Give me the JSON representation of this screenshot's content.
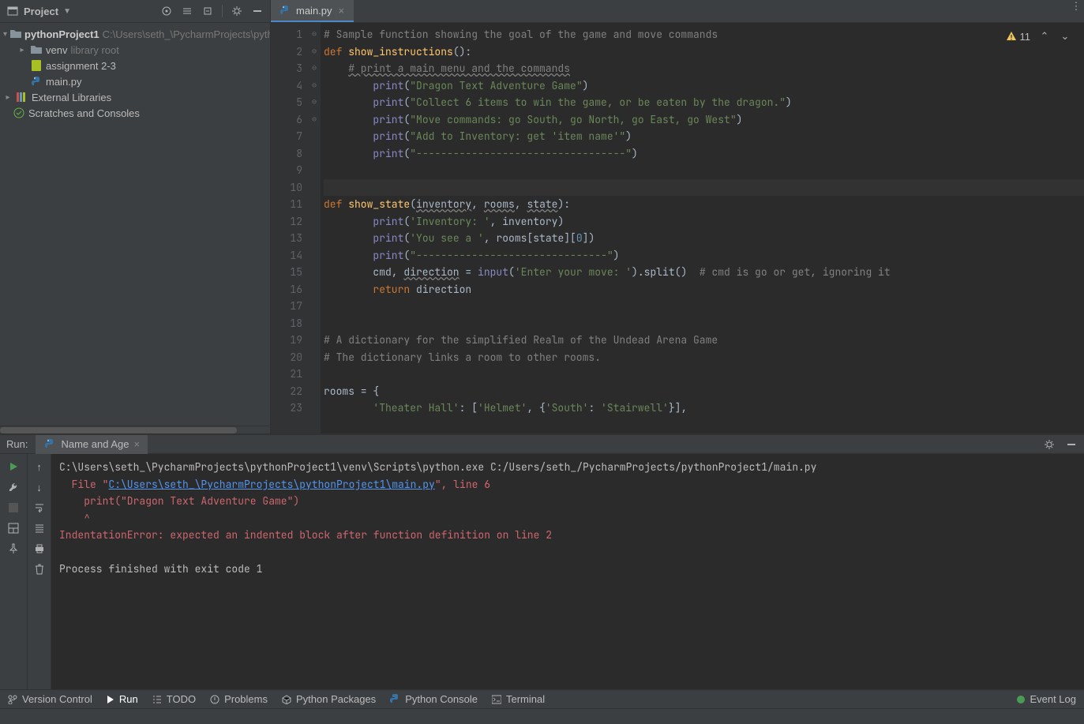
{
  "project_header": {
    "title": "Project"
  },
  "tree": {
    "project": {
      "name": "pythonProject1",
      "path": "C:\\Users\\seth_\\PycharmProjects\\python"
    },
    "venv": {
      "name": "venv",
      "tag": "library root"
    },
    "assign": "assignment 2-3",
    "main": "main.py",
    "ext": "External Libraries",
    "scratch": "Scratches and Consoles"
  },
  "editor_tab": {
    "file": "main.py"
  },
  "inspection": {
    "warn_count": "11"
  },
  "code_lines": [
    {
      "n": 1,
      "seg": [
        {
          "c": "c-cmt",
          "t": "# Sample function showing the goal of the game and move commands"
        }
      ]
    },
    {
      "n": 2,
      "fold": "⊖",
      "seg": [
        {
          "c": "c-kw",
          "t": "def "
        },
        {
          "c": "c-fn",
          "t": "show_instructions"
        },
        {
          "t": "():"
        }
      ]
    },
    {
      "n": 3,
      "seg": [
        {
          "t": "    "
        },
        {
          "c": "c-cmt",
          "t": "# print a main menu and the commands",
          "u": true
        }
      ]
    },
    {
      "n": 4,
      "fold": "⊖",
      "seg": [
        {
          "t": "        "
        },
        {
          "c": "c-blt",
          "t": "print"
        },
        {
          "t": "("
        },
        {
          "c": "c-str",
          "t": "\"Dragon Text Adventure Game\""
        },
        {
          "t": ")"
        }
      ]
    },
    {
      "n": 5,
      "seg": [
        {
          "t": "        "
        },
        {
          "c": "c-blt",
          "t": "print"
        },
        {
          "t": "("
        },
        {
          "c": "c-str",
          "t": "\"Collect 6 items to win the game, or be eaten by the dragon.\""
        },
        {
          "t": ")"
        }
      ]
    },
    {
      "n": 6,
      "seg": [
        {
          "t": "        "
        },
        {
          "c": "c-blt",
          "t": "print"
        },
        {
          "t": "("
        },
        {
          "c": "c-str",
          "t": "\"Move commands: go South, go North, go East, go West\""
        },
        {
          "t": ")"
        }
      ]
    },
    {
      "n": 7,
      "seg": [
        {
          "t": "        "
        },
        {
          "c": "c-blt",
          "t": "print"
        },
        {
          "t": "("
        },
        {
          "c": "c-str",
          "t": "\"Add to Inventory: get 'item name'\""
        },
        {
          "t": ")"
        }
      ]
    },
    {
      "n": 8,
      "fold": "⊖",
      "seg": [
        {
          "t": "        "
        },
        {
          "c": "c-blt",
          "t": "print"
        },
        {
          "t": "("
        },
        {
          "c": "c-str",
          "t": "\"----------------------------------\""
        },
        {
          "t": ")"
        }
      ]
    },
    {
      "n": 9,
      "seg": [
        {
          "t": ""
        }
      ]
    },
    {
      "n": 10,
      "current": true,
      "seg": [
        {
          "t": ""
        }
      ]
    },
    {
      "n": 11,
      "fold": "⊖",
      "seg": [
        {
          "c": "c-kw",
          "t": "def "
        },
        {
          "c": "c-fn",
          "t": "show_state"
        },
        {
          "t": "("
        },
        {
          "c": "c-und",
          "t": "inventory"
        },
        {
          "t": ", "
        },
        {
          "c": "c-und",
          "t": "rooms"
        },
        {
          "t": ", "
        },
        {
          "c": "c-und",
          "t": "state"
        },
        {
          "t": "):"
        }
      ]
    },
    {
      "n": 12,
      "seg": [
        {
          "t": "        "
        },
        {
          "c": "c-blt",
          "t": "print"
        },
        {
          "t": "("
        },
        {
          "c": "c-str",
          "t": "'Inventory: '"
        },
        {
          "t": ", inventory)"
        }
      ]
    },
    {
      "n": 13,
      "seg": [
        {
          "t": "        "
        },
        {
          "c": "c-blt",
          "t": "print"
        },
        {
          "t": "("
        },
        {
          "c": "c-str",
          "t": "'You see a '"
        },
        {
          "t": ", rooms[state]["
        },
        {
          "c": "c-num",
          "t": "0"
        },
        {
          "t": "])"
        }
      ]
    },
    {
      "n": 14,
      "seg": [
        {
          "t": "        "
        },
        {
          "c": "c-blt",
          "t": "print"
        },
        {
          "t": "("
        },
        {
          "c": "c-str",
          "t": "\"-------------------------------\""
        },
        {
          "t": ")"
        }
      ]
    },
    {
      "n": 15,
      "seg": [
        {
          "t": "        cmd, "
        },
        {
          "c": "c-und",
          "t": "direction"
        },
        {
          "t": " = "
        },
        {
          "c": "c-blt",
          "t": "input"
        },
        {
          "t": "("
        },
        {
          "c": "c-str",
          "t": "'Enter your move: '"
        },
        {
          "t": ").split()  "
        },
        {
          "c": "c-cmt",
          "t": "# cmd is go or get, ignoring it"
        }
      ]
    },
    {
      "n": 16,
      "fold": "⊖",
      "seg": [
        {
          "t": "        "
        },
        {
          "c": "c-kw",
          "t": "return "
        },
        {
          "t": "direction"
        }
      ]
    },
    {
      "n": 17,
      "seg": [
        {
          "t": ""
        }
      ]
    },
    {
      "n": 18,
      "seg": [
        {
          "t": ""
        }
      ]
    },
    {
      "n": 19,
      "seg": [
        {
          "c": "c-cmt",
          "t": "# A dictionary for the simplified Realm of the Undead Arena Game"
        }
      ]
    },
    {
      "n": 20,
      "seg": [
        {
          "c": "c-cmt",
          "t": "# The dictionary links a room to other rooms."
        }
      ]
    },
    {
      "n": 21,
      "seg": [
        {
          "t": ""
        }
      ]
    },
    {
      "n": 22,
      "fold": "⊖",
      "seg": [
        {
          "t": "rooms = {"
        }
      ]
    },
    {
      "n": 23,
      "seg": [
        {
          "t": "        "
        },
        {
          "c": "c-str",
          "t": "'Theater Hall'"
        },
        {
          "t": ": ["
        },
        {
          "c": "c-str",
          "t": "'Helmet'"
        },
        {
          "t": ", {"
        },
        {
          "c": "c-str",
          "t": "'South'"
        },
        {
          "t": ": "
        },
        {
          "c": "c-str",
          "t": "'Stairwell'"
        },
        {
          "t": "}],"
        }
      ]
    }
  ],
  "run": {
    "label": "Run:",
    "tab": "Name and Age",
    "out": {
      "l1": "C:\\Users\\seth_\\PycharmProjects\\pythonProject1\\venv\\Scripts\\python.exe C:/Users/seth_/PycharmProjects/pythonProject1/main.py",
      "l2a": "  File \"",
      "l2link": "C:\\Users\\seth_\\PycharmProjects\\pythonProject1\\main.py",
      "l2b": "\", line 6",
      "l3": "    print(\"Dragon Text Adventure Game\")",
      "l4": "    ^",
      "l5": "IndentationError: expected an indented block after function definition on line 2",
      "l6": "",
      "l7": "Process finished with exit code 1"
    }
  },
  "toolwin": {
    "vc": "Version Control",
    "run": "Run",
    "todo": "TODO",
    "problems": "Problems",
    "pkg": "Python Packages",
    "pycon": "Python Console",
    "term": "Terminal"
  },
  "status": {
    "evtlog": "Event Log"
  }
}
